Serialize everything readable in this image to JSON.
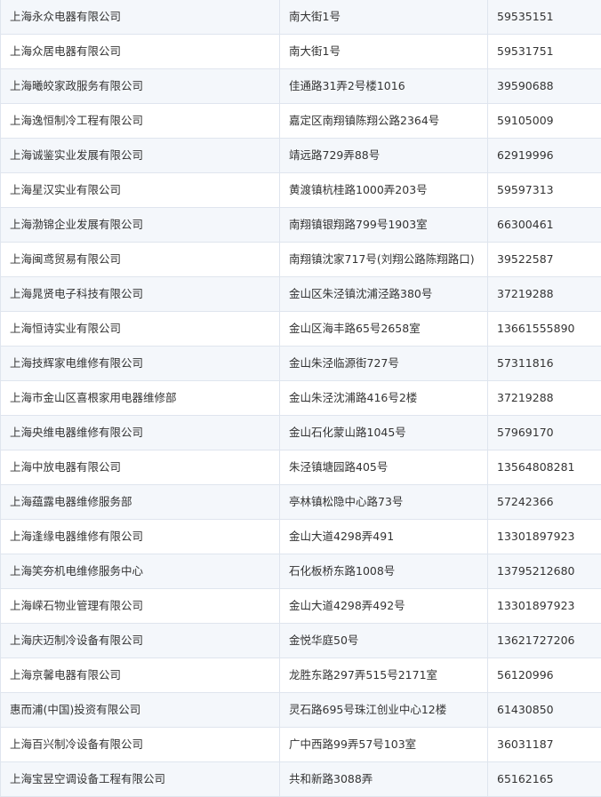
{
  "table": {
    "rows": [
      {
        "name": "上海永众电器有限公司",
        "address": "南大街1号",
        "phone": "59535151"
      },
      {
        "name": "上海众居电器有限公司",
        "address": "南大街1号",
        "phone": "59531751"
      },
      {
        "name": "上海曦皎家政服务有限公司",
        "address": "佳通路31弄2号楼1016",
        "phone": "39590688"
      },
      {
        "name": "上海逸恒制冷工程有限公司",
        "address": "嘉定区南翔镇陈翔公路2364号",
        "phone": "59105009"
      },
      {
        "name": "上海诚鉴实业发展有限公司",
        "address": "靖远路729弄88号",
        "phone": "62919996"
      },
      {
        "name": "上海星汉实业有限公司",
        "address": "黄渡镇杭桂路1000弄203号",
        "phone": "59597313"
      },
      {
        "name": "上海渤锦企业发展有限公司",
        "address": "南翔镇银翔路799号1903室",
        "phone": "66300461"
      },
      {
        "name": "上海闽鸢贸易有限公司",
        "address": "南翔镇沈家717号(刘翔公路陈翔路口)",
        "phone": "39522587"
      },
      {
        "name": "上海晁贤电子科技有限公司",
        "address": "金山区朱泾镇沈浦泾路380号",
        "phone": "37219288"
      },
      {
        "name": "上海恒诗实业有限公司",
        "address": "金山区海丰路65号2658室",
        "phone": "13661555890"
      },
      {
        "name": "上海技辉家电维修有限公司",
        "address": "金山朱泾临源街727号",
        "phone": "57311816"
      },
      {
        "name": "上海市金山区喜根家用电器维修部",
        "address": "金山朱泾沈浦路416号2楼",
        "phone": "37219288"
      },
      {
        "name": "上海央维电器维修有限公司",
        "address": "金山石化蒙山路1045号",
        "phone": "57969170"
      },
      {
        "name": "上海中放电器有限公司",
        "address": "朱泾镇塘园路405号",
        "phone": "13564808281"
      },
      {
        "name": "上海蕴露电器维修服务部",
        "address": "亭林镇松隐中心路73号",
        "phone": "57242366"
      },
      {
        "name": "上海逢缘电器维修有限公司",
        "address": "金山大道4298弄491",
        "phone": "13301897923"
      },
      {
        "name": "上海笑夯机电维修服务中心",
        "address": "石化板桥东路1008号",
        "phone": "13795212680"
      },
      {
        "name": "上海嵘石物业管理有限公司",
        "address": "金山大道4298弄492号",
        "phone": "13301897923"
      },
      {
        "name": "上海庆迈制冷设备有限公司",
        "address": "金悦华庭50号",
        "phone": "13621727206"
      },
      {
        "name": "上海京馨电器有限公司",
        "address": "龙胜东路297弄515号2171室",
        "phone": "56120996"
      },
      {
        "name": "惠而浦(中国)投资有限公司",
        "address": "灵石路695号珠江创业中心12楼",
        "phone": "61430850"
      },
      {
        "name": "上海百兴制冷设备有限公司",
        "address": "广中西路99弄57号103室",
        "phone": "36031187"
      },
      {
        "name": "上海宝昱空调设备工程有限公司",
        "address": "共和新路3088弄",
        "phone": "65162165"
      }
    ]
  }
}
